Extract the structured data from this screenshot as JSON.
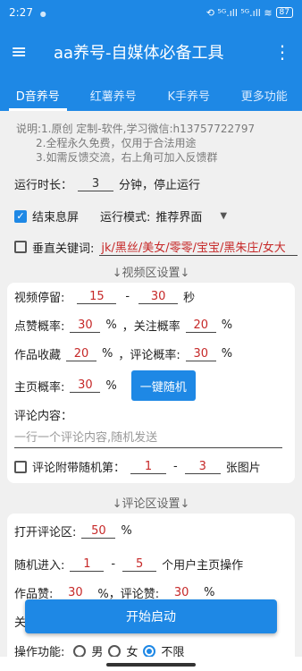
{
  "status": {
    "time": "2:27",
    "dot": "●",
    "icons": "⟲ ⁵ᴳ.ıll ⁵ᴳ.ıll ≋",
    "battery": "87"
  },
  "appbar": {
    "title": "aa养号-自媒体必备工具",
    "menu_icon": "≡",
    "more_icon": "⋮"
  },
  "tabs": [
    "D音养号",
    "红薯养号",
    "K手养号",
    "更多功能"
  ],
  "desc": [
    "说明:1.原创 定制-软件,学习微信:h13757722797",
    "2.全程永久免费，仅用于合法用途",
    "3.如需反馈交流，右上角可加入反馈群"
  ],
  "runtime": {
    "label": "运行时长：",
    "value": "3",
    "suffix": "分钟，停止运行"
  },
  "end_screen": {
    "label": "结束息屏",
    "mode_label": "运行模式:",
    "mode_value": "推荐界面",
    "checked": true
  },
  "keywords": {
    "label": "垂直关键词:",
    "value": "jk/黑丝/美女/零零/宝宝/黑朱庄/女大"
  },
  "video_section": "↓视频区设置↓",
  "video": {
    "stay_label": "视频停留:",
    "stay_min": "15",
    "dash": "-",
    "stay_max": "30",
    "stay_unit": "秒",
    "like_label": "点赞概率:",
    "like": "30",
    "pct": "%",
    "follow_label": "，关注概率",
    "follow": "20",
    "fav_label": "作品收藏",
    "fav": "20",
    "comment_label": "，评论概率:",
    "comment": "30",
    "home_label": "主页概率:",
    "home": "30",
    "random_button": "一键随机",
    "content_label": "评论内容：",
    "content_placeholder": "一行一个评论内容,随机发送",
    "img_label": "评论附带随机第：",
    "img_min": "1",
    "img_max": "3",
    "img_unit": "张图片"
  },
  "comment_section": "↓评论区设置↓",
  "comment": {
    "open_label": "打开评论区:",
    "open": "50",
    "pct": "%",
    "enter_label": "随机进入:",
    "enter_min": "1",
    "dash": "-",
    "enter_max": "5",
    "enter_unit": "个用户主页操作",
    "work_like_label": "作品赞:",
    "work_like": "30",
    "comment_like_label": "%，评论赞:",
    "comment_like": "30",
    "partial": "关",
    "start_button": "开始启动",
    "gender_label": "操作功能:",
    "male": "男",
    "female": "女",
    "unlimited": "不限"
  }
}
